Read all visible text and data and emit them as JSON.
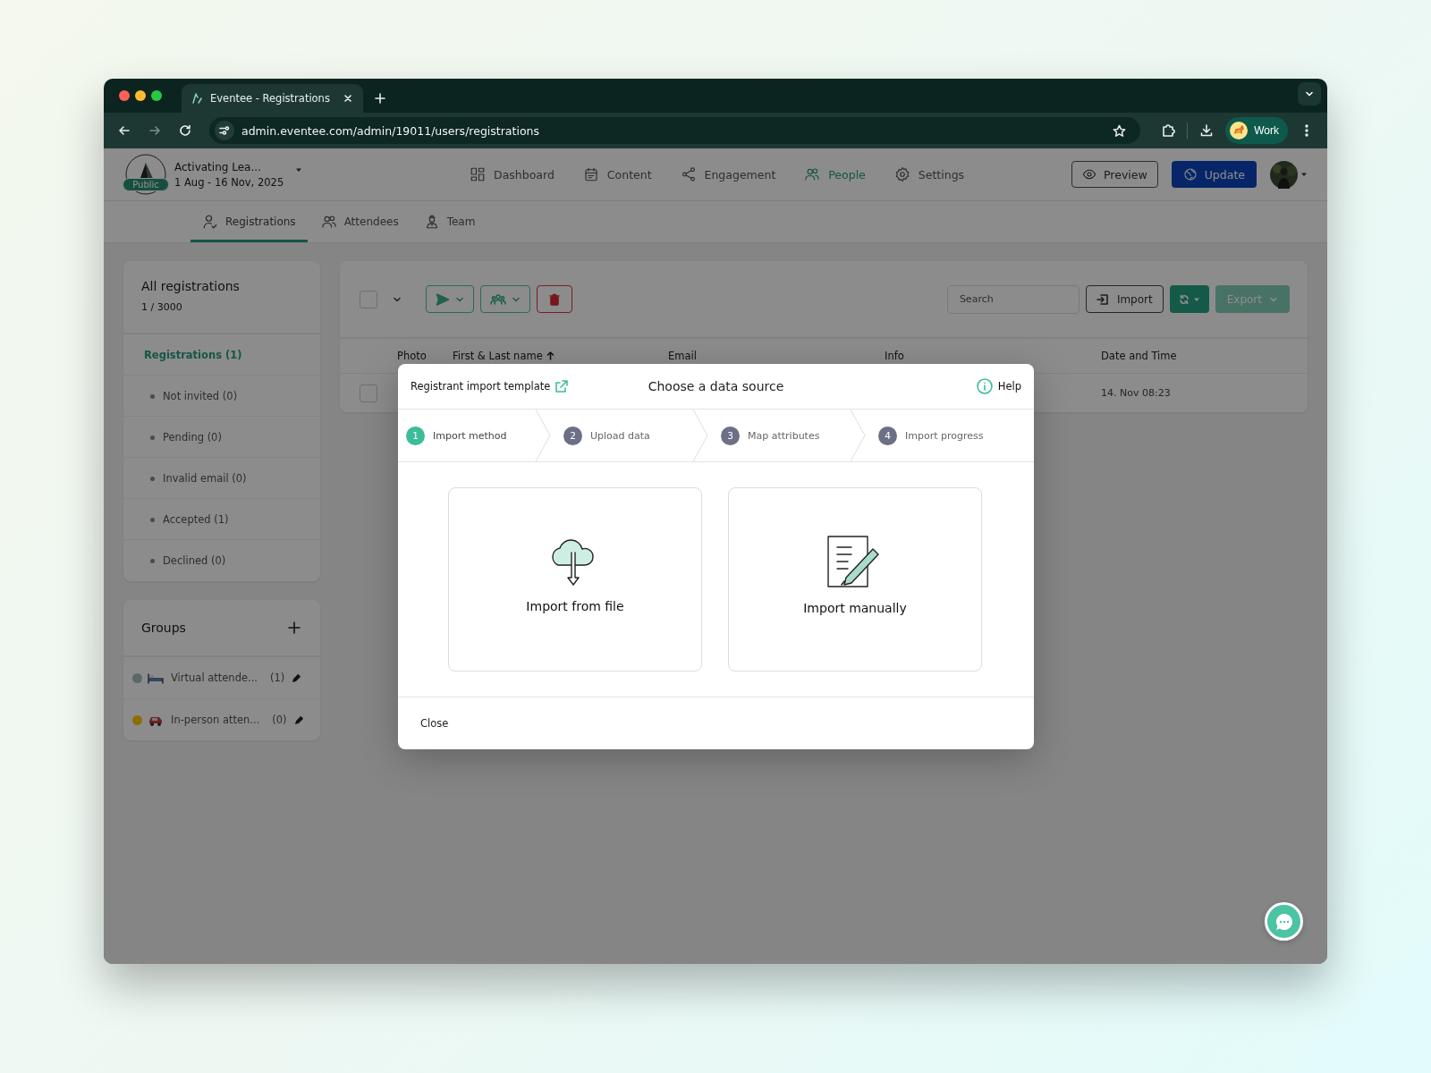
{
  "browser": {
    "tab_title": "Eventee - Registrations",
    "url": "admin.eventee.com/admin/19011/users/registrations",
    "profile": "Work"
  },
  "event": {
    "badge": "Public",
    "name": "Activating Lea...",
    "dates": "1 Aug - 16 Nov, 2025"
  },
  "nav": [
    {
      "label": "Dashboard",
      "selected": false
    },
    {
      "label": "Content",
      "selected": false
    },
    {
      "label": "Engagement",
      "selected": false
    },
    {
      "label": "People",
      "selected": true
    },
    {
      "label": "Settings",
      "selected": false
    }
  ],
  "header_buttons": {
    "preview": "Preview",
    "update": "Update"
  },
  "subnav": [
    {
      "label": "Registrations",
      "selected": true
    },
    {
      "label": "Attendees",
      "selected": false
    },
    {
      "label": "Team",
      "selected": false
    }
  ],
  "sidebar": {
    "title": "All registrations",
    "count": "1 / 3000",
    "items": [
      {
        "label": "Registrations (1)",
        "selected": true,
        "children": [
          {
            "label": "Not invited (0)",
            "selected": false
          },
          {
            "label": "Pending (0)",
            "selected": false
          },
          {
            "label": "Invalid email (0)",
            "selected": false
          },
          {
            "label": "Accepted (1)",
            "selected": false
          },
          {
            "label": "Declined (0)",
            "selected": false
          }
        ]
      }
    ]
  },
  "groups": {
    "title": "Groups",
    "items": [
      {
        "name": "Virtual attende...",
        "count": "(1)",
        "color": "#5b6868"
      },
      {
        "name": "In-person atten...",
        "count": "(0)",
        "color": "#8a6f00"
      }
    ]
  },
  "table": {
    "search": {
      "placeholder": "Search"
    },
    "import": "Import",
    "export": "Export",
    "select_all": {
      "checked": false
    },
    "columns": [
      {
        "label": "Photo",
        "sorted": false
      },
      {
        "label": "First & Last name",
        "sorted": true
      },
      {
        "label": "Email",
        "sorted": false
      },
      {
        "label": "Info",
        "sorted": false
      },
      {
        "label": "Date and Time",
        "sorted": false
      }
    ],
    "rows": [
      {
        "checked": false,
        "date_and_time": "14. Nov 08:23"
      }
    ]
  },
  "modal": {
    "template_link": "Registrant import template",
    "title": "Choose a data source",
    "help": "Help",
    "steps": [
      {
        "number": "1",
        "label": "Import method",
        "selected": true
      },
      {
        "number": "2",
        "label": "Upload data",
        "selected": false
      },
      {
        "number": "3",
        "label": "Map attributes",
        "selected": false
      },
      {
        "number": "4",
        "label": "Import progress",
        "selected": false
      }
    ],
    "options": [
      {
        "kind": "file",
        "label": "Import from file"
      },
      {
        "kind": "manual",
        "label": "Import manually"
      }
    ],
    "close": "Close"
  }
}
